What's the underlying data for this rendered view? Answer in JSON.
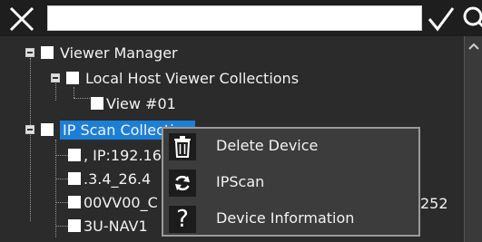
{
  "toolbar": {
    "close_icon": "close-x-icon",
    "search_value": "",
    "confirm_icon": "checkmark-icon",
    "search_icon": "search-icon"
  },
  "tree": {
    "items": [
      {
        "label": "Viewer Manager",
        "level": 0,
        "expanded": true
      },
      {
        "label": "Local Host Viewer Collections",
        "level": 1,
        "expanded": true
      },
      {
        "label": "View #01",
        "level": 2
      },
      {
        "label": "IP Scan Collection",
        "level": 0,
        "expanded": true,
        "selected": true
      },
      {
        "label": ", IP:192.16",
        "level": 1
      },
      {
        "label": ".3.4_26.4",
        "level": 1
      },
      {
        "label": "00VV00_C",
        "level": 1,
        "suffix": "252"
      },
      {
        "label": "3U-NAV1",
        "level": 1
      }
    ]
  },
  "context_menu": {
    "items": [
      {
        "label": "Delete Device",
        "icon": "trash-icon"
      },
      {
        "label": "IPScan",
        "icon": "refresh-icon"
      },
      {
        "label": "Device Information",
        "icon": "question-icon"
      }
    ]
  },
  "colors": {
    "selection": "#1c7fd6",
    "tree_bg": "#2b2b2b",
    "toolbar_bg": "#1e1e1e",
    "menu_bg": "#3c3c3c"
  }
}
